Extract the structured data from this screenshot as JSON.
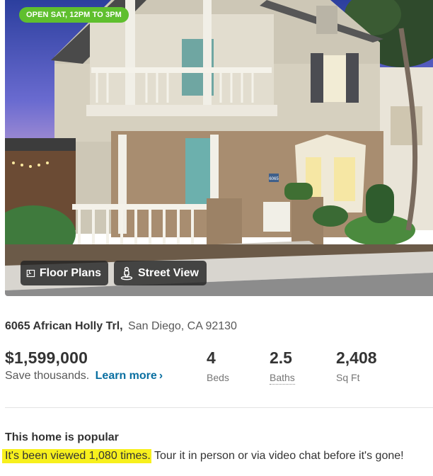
{
  "photo": {
    "open_house_badge": "OPEN SAT, 12PM TO 3PM",
    "house_number_plate": "6065",
    "floor_plans_label": "Floor Plans",
    "street_view_label": "Street View"
  },
  "listing": {
    "street": "6065 African Holly Trl,",
    "city_state_zip": "San Diego, CA 92130",
    "price": "$1,599,000",
    "save_text": "Save thousands.",
    "learn_more": "Learn more",
    "learn_more_chevron": "›",
    "beds_value": "4",
    "beds_label": "Beds",
    "baths_value": "2.5",
    "baths_label": "Baths",
    "sqft_value": "2,408",
    "sqft_label": "Sq Ft"
  },
  "popularity": {
    "title": "This home is popular",
    "highlighted": "It's been viewed 1,080 times.",
    "rest": " Tour it in person or via video chat before it's gone!"
  },
  "colors": {
    "badge_green": "#5fbf2e",
    "link_blue": "#0a6fa1",
    "highlight_yellow": "#f7f01d"
  },
  "icons": {
    "floor_plans": "floor-plan-icon",
    "street_view": "street-view-person-icon"
  }
}
